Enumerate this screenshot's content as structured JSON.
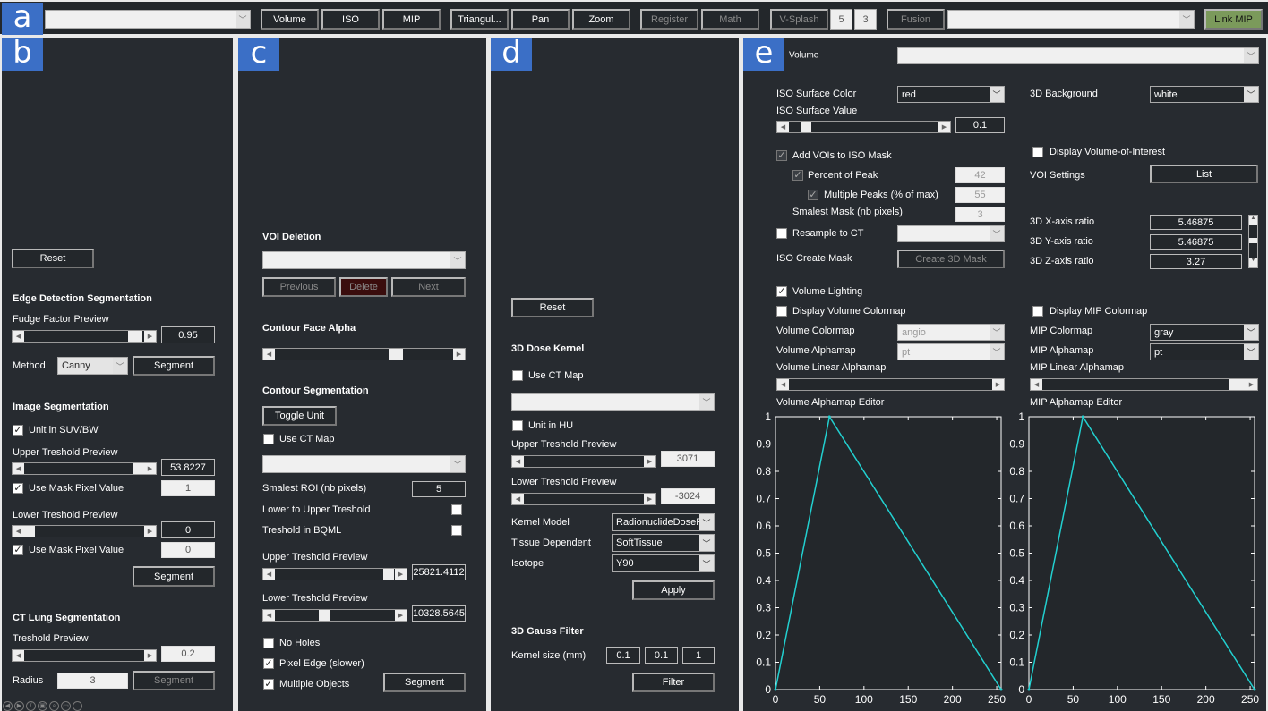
{
  "toolbar": {
    "tag": "a",
    "buttons": {
      "volume": "Volume",
      "iso": "ISO",
      "mip": "MIP",
      "triangulate": "Triangul...",
      "pan": "Pan",
      "zoom": "Zoom",
      "register": "Register",
      "math": "Math",
      "vsplash": "V-Splash",
      "vs1": "5",
      "vs2": "3",
      "fusion": "Fusion",
      "link_mip": "Link MIP"
    },
    "link_mip_color": "#7b9a5b"
  },
  "panel_b": {
    "tag": "b",
    "reset": "Reset",
    "edge": {
      "title": "Edge Detection Segmentation",
      "fudge_label": "Fudge Factor Preview",
      "fudge_value": "0.95",
      "method_label": "Method",
      "method": "Canny",
      "segment": "Segment"
    },
    "image": {
      "title": "Image Segmentation",
      "unit": "Unit in SUV/BW",
      "upper_label": "Upper Treshold Preview",
      "upper_value": "53.8227",
      "use_mask1": "Use Mask Pixel Value",
      "mask1_value": "1",
      "lower_label": "Lower Treshold Preview",
      "lower_value": "0",
      "use_mask2": "Use Mask Pixel Value",
      "mask2_value": "0",
      "segment": "Segment"
    },
    "lung": {
      "title": "CT Lung Segmentation",
      "threshold_label": "Treshold Preview",
      "threshold_value": "0.2",
      "radius_label": "Radius",
      "radius_value": "3",
      "segment": "Segment"
    }
  },
  "panel_c": {
    "tag": "c",
    "voi": {
      "title": "VOI Deletion",
      "previous": "Previous",
      "delete": "Delete",
      "next": "Next"
    },
    "alpha": {
      "title": "Contour Face Alpha"
    },
    "contour": {
      "title": "Contour Segmentation",
      "toggle": "Toggle Unit",
      "use_ct": "Use CT Map",
      "smallest_label": "Smalest ROI (nb pixels)",
      "smallest_value": "5",
      "lower_to_upper": "Lower to Upper Treshold",
      "bqml": "Treshold in BQML",
      "upper_label": "Upper Treshold Preview",
      "upper_value": "25821.4112",
      "lower_label": "Lower Treshold Preview",
      "lower_value": "10328.5645",
      "no_holes": "No Holes",
      "pixel_edge": "Pixel Edge (slower)",
      "multiple": "Multiple Objects",
      "segment": "Segment"
    }
  },
  "panel_d": {
    "tag": "d",
    "reset": "Reset",
    "dose": {
      "title": "3D Dose Kernel",
      "use_ct": "Use CT Map",
      "unit_hu": "Unit in HU",
      "upper_label": "Upper Treshold Preview",
      "upper_value": "3071",
      "lower_label": "Lower Treshold Preview",
      "lower_value": "-3024",
      "kernel_label": "Kernel Model",
      "kernel": "RadionuclideDoseP...",
      "tissue_label": "Tissue Dependent",
      "tissue": "SoftTissue",
      "isotope_label": "Isotope",
      "isotope": "Y90",
      "apply": "Apply"
    },
    "gauss": {
      "title": "3D Gauss Filter",
      "kernel_label": "Kernel size (mm)",
      "kx": "0.1",
      "ky": "0.1",
      "kz": "1",
      "filter": "Filter"
    }
  },
  "panel_e": {
    "tag": "e",
    "volume_label": "Volume",
    "iso_color_label": "ISO Surface Color",
    "iso_color": "red",
    "bg_label": "3D Background",
    "bg": "white",
    "iso_value_label": "ISO Surface Value",
    "iso_value": "0.1",
    "add_vois": "Add VOIs to ISO Mask",
    "display_voi": "Display Volume-of-Interest",
    "percent_peak": "Percent of Peak",
    "percent_value": "42",
    "voi_settings": "VOI Settings",
    "list": "List",
    "multi_peaks": "Multiple Peaks (% of max)",
    "multi_value": "55",
    "smallest_mask": "Smalest Mask (nb pixels)",
    "smallest_value": "3",
    "x_ratio_label": "3D X-axis ratio",
    "x_ratio": "5.46875",
    "y_ratio_label": "3D Y-axis ratio",
    "y_ratio": "5.46875",
    "z_ratio_label": "3D Z-axis ratio",
    "z_ratio": "3.27",
    "resample": "Resample to CT",
    "create_mask_label": "ISO Create Mask",
    "create_mask": "Create 3D Mask",
    "lighting": "Volume Lighting",
    "display_vol_cmap": "Display Volume Colormap",
    "display_mip_cmap": "Display MIP Colormap",
    "vol_cmap_label": "Volume Colormap",
    "vol_cmap": "angio",
    "mip_cmap_label": "MIP Colormap",
    "mip_cmap": "gray",
    "vol_amap_label": "Volume Alphamap",
    "vol_amap": "pt",
    "mip_amap_label": "MIP Alphamap",
    "mip_amap": "pt",
    "vol_linear_label": "Volume Linear Alphamap",
    "mip_linear_label": "MIP Linear Alphamap",
    "vol_editor_label": "Volume Alphamap Editor",
    "mip_editor_label": "MIP Alphamap Editor"
  },
  "chart_data": [
    {
      "type": "line",
      "xlim": [
        0,
        255
      ],
      "ylim": [
        0,
        1
      ],
      "xticks": [
        0,
        50,
        100,
        150,
        200,
        250
      ],
      "yticks": [
        0,
        0.1,
        0.2,
        0.3,
        0.4,
        0.5,
        0.6,
        0.7,
        0.8,
        0.9,
        1
      ],
      "x": [
        0,
        61,
        255
      ],
      "y": [
        0,
        1,
        0
      ],
      "color": "#22d0d0",
      "background": "#23272b"
    },
    {
      "type": "line",
      "xlim": [
        0,
        255
      ],
      "ylim": [
        0,
        1
      ],
      "xticks": [
        0,
        50,
        100,
        150,
        200,
        250
      ],
      "yticks": [
        0,
        0.1,
        0.2,
        0.3,
        0.4,
        0.5,
        0.6,
        0.7,
        0.8,
        0.9,
        1
      ],
      "x": [
        0,
        61,
        255
      ],
      "y": [
        0,
        1,
        0
      ],
      "color": "#22d0d0",
      "background": "#23272b"
    }
  ]
}
